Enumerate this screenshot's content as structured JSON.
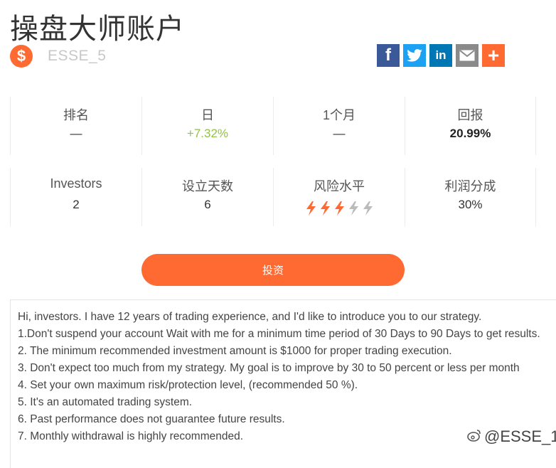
{
  "header": {
    "title": "操盘大师账户",
    "username": "ESSE_5",
    "dollar_symbol": "$"
  },
  "share": {
    "facebook": "f",
    "twitter": "t",
    "linkedin": "in",
    "email": "✉",
    "plus": "+"
  },
  "stats_row1": [
    {
      "label": "排名",
      "value": "—"
    },
    {
      "label": "日",
      "value": "+7.32%"
    },
    {
      "label": "1个月",
      "value": "—"
    },
    {
      "label": "回报",
      "value": "20.99%"
    }
  ],
  "stats_row2": [
    {
      "label": "Investors",
      "value": "2"
    },
    {
      "label": "设立天数",
      "value": "6"
    },
    {
      "label": "风险水平",
      "risk_level": 3,
      "risk_max": 5
    },
    {
      "label": "利润分成",
      "value": "30%"
    }
  ],
  "colors": {
    "accent": "#ff6a33",
    "positive": "#93c24a",
    "risk_active": "#ff6a33",
    "risk_inactive": "#bbbbbb"
  },
  "invest_button": "投资",
  "description": [
    "Hi, investors. I have 12 years of trading experience, and I'd like to introduce you to our strategy.",
    "1.Don't suspend your account Wait with me for a minimum time period of 30 Days to 90 Days to get results.",
    "2. The minimum recommended investment amount is $1000 for proper trading execution.",
    "3. Don't expect too much from my strategy. My goal is to improve by 30 to 50 percent or less per month",
    "4. Set your own maximum risk/protection level, (recommended 50 %).",
    "5. It's an automated trading system.",
    "6. Past performance does not guarantee future results.",
    "7. Monthly withdrawal is highly recommended."
  ],
  "watermark": "@ESSE_1"
}
